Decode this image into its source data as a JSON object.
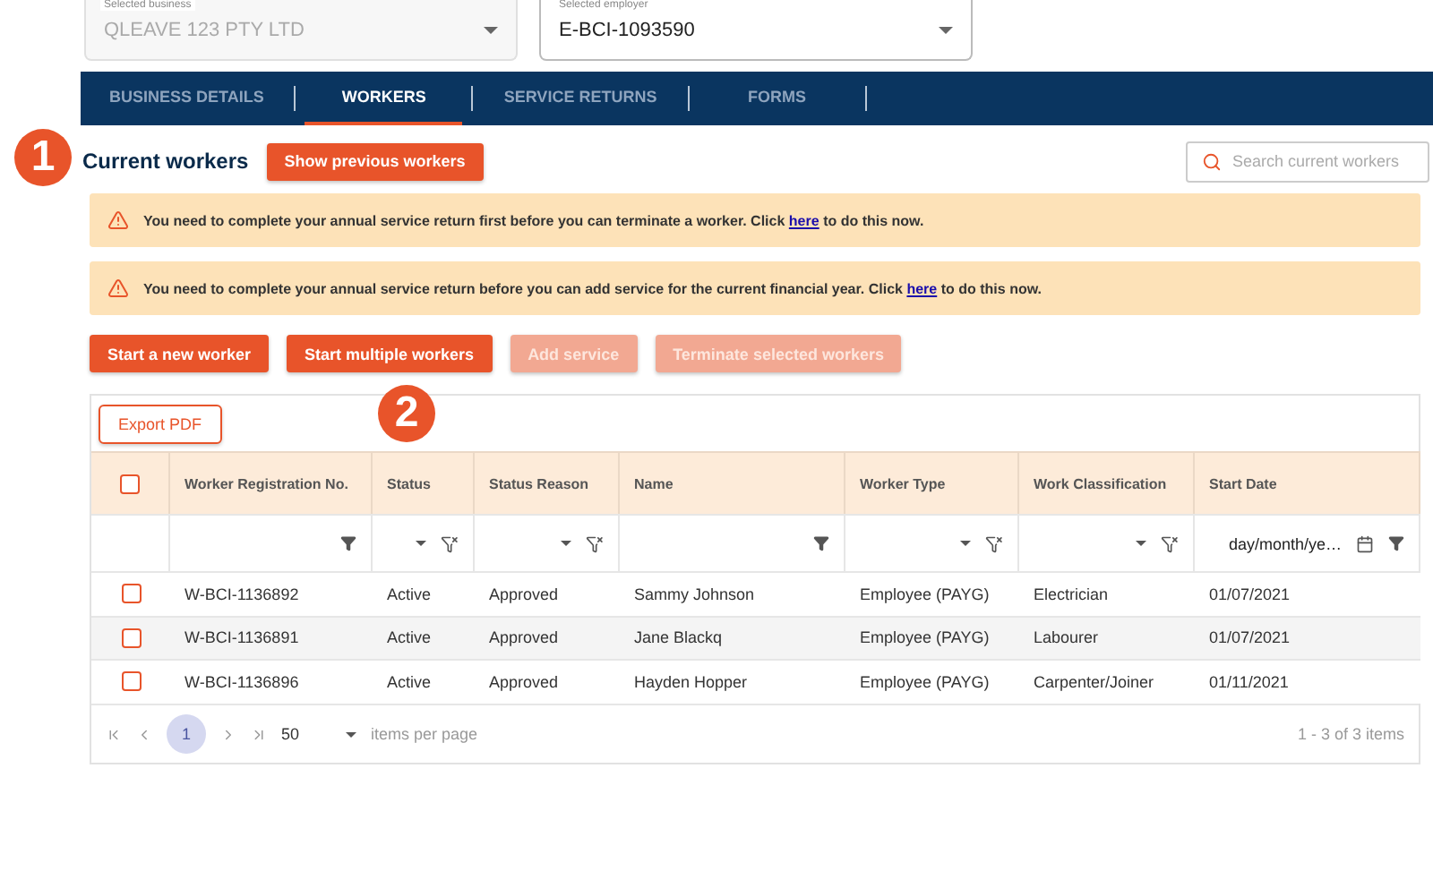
{
  "selectors": [
    {
      "label": "Selected business",
      "value": "QLEAVE 123 PTY LTD",
      "disabled": true
    },
    {
      "label": "Selected employer",
      "value": "E-BCI-1093590",
      "disabled": false
    }
  ],
  "tabs": [
    {
      "label": "BUSINESS DETAILS",
      "selected": false
    },
    {
      "label": "WORKERS",
      "selected": true
    },
    {
      "label": "SERVICE RETURNS",
      "selected": false
    },
    {
      "label": "FORMS",
      "selected": false
    }
  ],
  "step_badges": [
    "1",
    "2"
  ],
  "heading": "Current workers",
  "show_previous_button": "Show previous workers",
  "search": {
    "placeholder": "Search current workers"
  },
  "alerts": [
    {
      "before": "You need to complete your annual service return first before you can terminate a worker. Click",
      "link": "here",
      "after": "to do this now."
    },
    {
      "before": "You need to complete your annual service return before you can add service for the current financial year. Click",
      "link": "here",
      "after": "to do this now."
    }
  ],
  "actions": [
    {
      "label": "Start a new worker",
      "disabled": false
    },
    {
      "label": "Start multiple workers",
      "disabled": false
    },
    {
      "label": "Add service",
      "disabled": true
    },
    {
      "label": "Terminate selected workers",
      "disabled": true
    }
  ],
  "export_button": "Export PDF",
  "table": {
    "select_all_checked": false,
    "columns": [
      {
        "label": "Worker Registration No.",
        "kind": "text"
      },
      {
        "label": "Status",
        "kind": "dropdown"
      },
      {
        "label": "Status Reason",
        "kind": "dropdown"
      },
      {
        "label": "Name",
        "kind": "text"
      },
      {
        "label": "Worker Type",
        "kind": "dropdown"
      },
      {
        "label": "Work Classification",
        "kind": "dropdown"
      },
      {
        "label": "Start Date",
        "kind": "date",
        "placeholder": "day/month/ye…"
      }
    ],
    "rows": [
      {
        "checked": false,
        "cells": [
          "W-BCI-1136892",
          "Active",
          "Approved",
          "Sammy Johnson",
          "Employee (PAYG)",
          "Electrician",
          "01/07/2021"
        ]
      },
      {
        "checked": false,
        "cells": [
          "W-BCI-1136891",
          "Active",
          "Approved",
          "Jane Blackq",
          "Employee (PAYG)",
          "Labourer",
          "01/07/2021"
        ]
      },
      {
        "checked": false,
        "cells": [
          "W-BCI-1136896",
          "Active",
          "Approved",
          "Hayden Hopper",
          "Employee (PAYG)",
          "Carpenter/Joiner",
          "01/11/2021"
        ]
      }
    ]
  },
  "pager": {
    "pages": [
      {
        "label": "1",
        "selected": true
      }
    ],
    "page_size": "50",
    "page_size_label": "items per page",
    "summary": "1 - 3 of 3 items"
  }
}
